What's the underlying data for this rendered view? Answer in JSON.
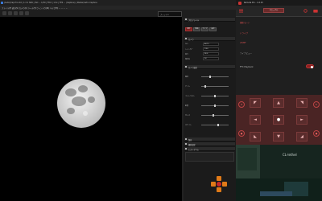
{
  "app": {
    "title": "(Astro)Cap Pro Ltd | 1.3.1 SDK | ISO ... 1/50 | F8.0 | 1.5x | FPS ... (Capture) | Stellar/Astro Capture"
  },
  "menubar": {
    "text": "ファイル(F)   表示(V)   カメラ(C)   ツール(T)   ウィンドウ(W)   ヘルプ(H)   ...   ...   ...   ..."
  },
  "toolbar": {
    "text": "...   ...   ...   ...   ...",
    "zoom_value": "フィット ▾"
  },
  "panel": {
    "sections": [
      "プロファイル",
      "カメラ",
      "カメラ設定",
      "保存",
      "撮影設定",
      "ヒストグラム"
    ],
    "modes": [
      "撮影",
      "動画",
      "ライブ",
      "設定"
    ],
    "rows": [
      {
        "k": "ISO",
        "v": "AUTO"
      },
      {
        "k": "シャッター",
        "v": "1/50"
      },
      {
        "k": "絞り",
        "v": "F8.0"
      },
      {
        "k": "保存先",
        "v": "D:\\"
      }
    ],
    "sliders": [
      "露出",
      "ゲイン",
      "コントラスト",
      "彩度",
      "ガンマ",
      "ホワイト"
    ]
  },
  "remote": {
    "title": "Remote Pro - 1.6.15",
    "mode": "マニュアル",
    "items": [
      "撮影モード",
      "ドライブ",
      "AF/MF",
      "ライブビュー"
    ],
    "ffc_label": "FFC Playback",
    "ffc_on": true,
    "dpad": [
      "◄",
      "▲",
      "►",
      "▼",
      "●"
    ],
    "stream_caption": "CL-lethel"
  },
  "colors": {
    "accent": "#c82828",
    "orange": "#e07a18"
  }
}
